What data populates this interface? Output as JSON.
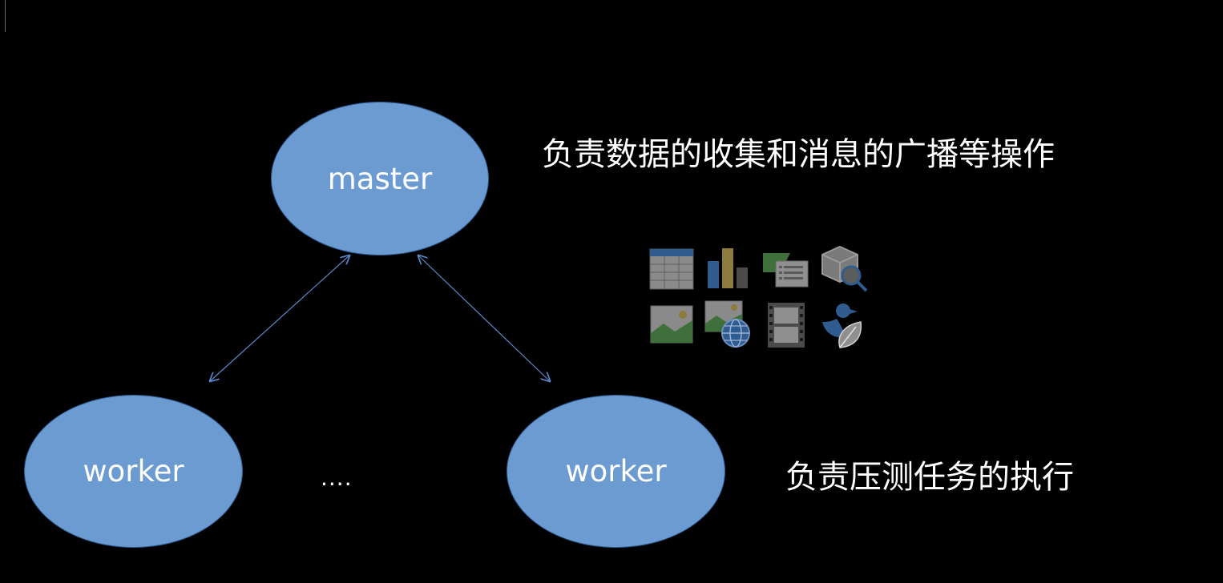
{
  "diagram": {
    "master": {
      "label": "master"
    },
    "workers": [
      {
        "label": "worker"
      },
      {
        "label": "worker"
      }
    ],
    "ellipsis": "....",
    "captions": {
      "master": "负责数据的收集和消息的广播等操作",
      "worker": "负责压测任务的执行"
    },
    "colors": {
      "background": "#000000",
      "node_fill": "#6b9bd1",
      "node_stroke": "#2e5f97",
      "connector": "#5b87c9",
      "text": "#ffffff"
    },
    "icons": [
      "table-icon",
      "bar-chart-icon",
      "flag-list-icon",
      "cube-search-icon",
      "picture-icon",
      "web-picture-icon",
      "film-icon",
      "duck-leaf-icon"
    ]
  }
}
